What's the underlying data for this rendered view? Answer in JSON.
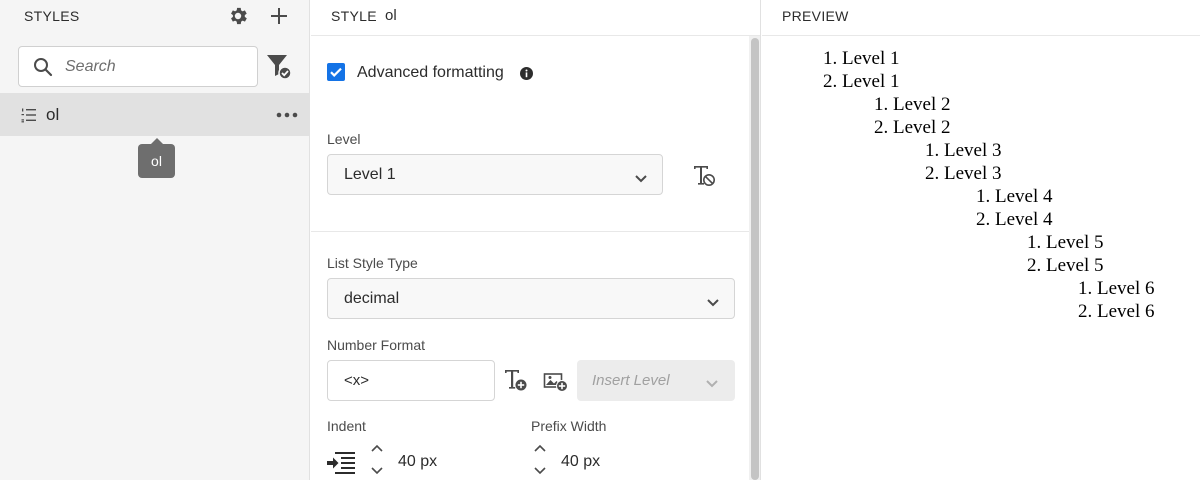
{
  "left_panel": {
    "title": "STYLES",
    "search_placeholder": "Search",
    "style_item": {
      "label": "ol"
    },
    "tooltip": "ol"
  },
  "middle_panel": {
    "title": "STYLE",
    "style_name": "ol",
    "advanced_formatting": {
      "label": "Advanced formatting",
      "checked": true
    },
    "level": {
      "label": "Level",
      "value": "Level 1"
    },
    "list_style_type": {
      "label": "List Style Type",
      "value": "decimal"
    },
    "number_format": {
      "label": "Number Format",
      "value": "<x>",
      "insert_level_placeholder": "Insert Level"
    },
    "indent": {
      "label": "Indent",
      "value": "40 px"
    },
    "prefix_width": {
      "label": "Prefix Width",
      "value": "40 px"
    }
  },
  "preview_panel": {
    "title": "PREVIEW",
    "lines": [
      "1. Level 1",
      "2. Level 1",
      "1. Level 2",
      "2. Level 2",
      "1. Level 3",
      "2. Level 3",
      "1. Level 4",
      "2. Level 4",
      "1. Level 5",
      "2. Level 5",
      "1. Level 6",
      "2. Level 6"
    ]
  },
  "colors": {
    "accent": "#1473e6",
    "panel_bg": "#f5f5f5",
    "selected_row": "#e1e1e1",
    "tooltip_bg": "#6e6e6e"
  }
}
